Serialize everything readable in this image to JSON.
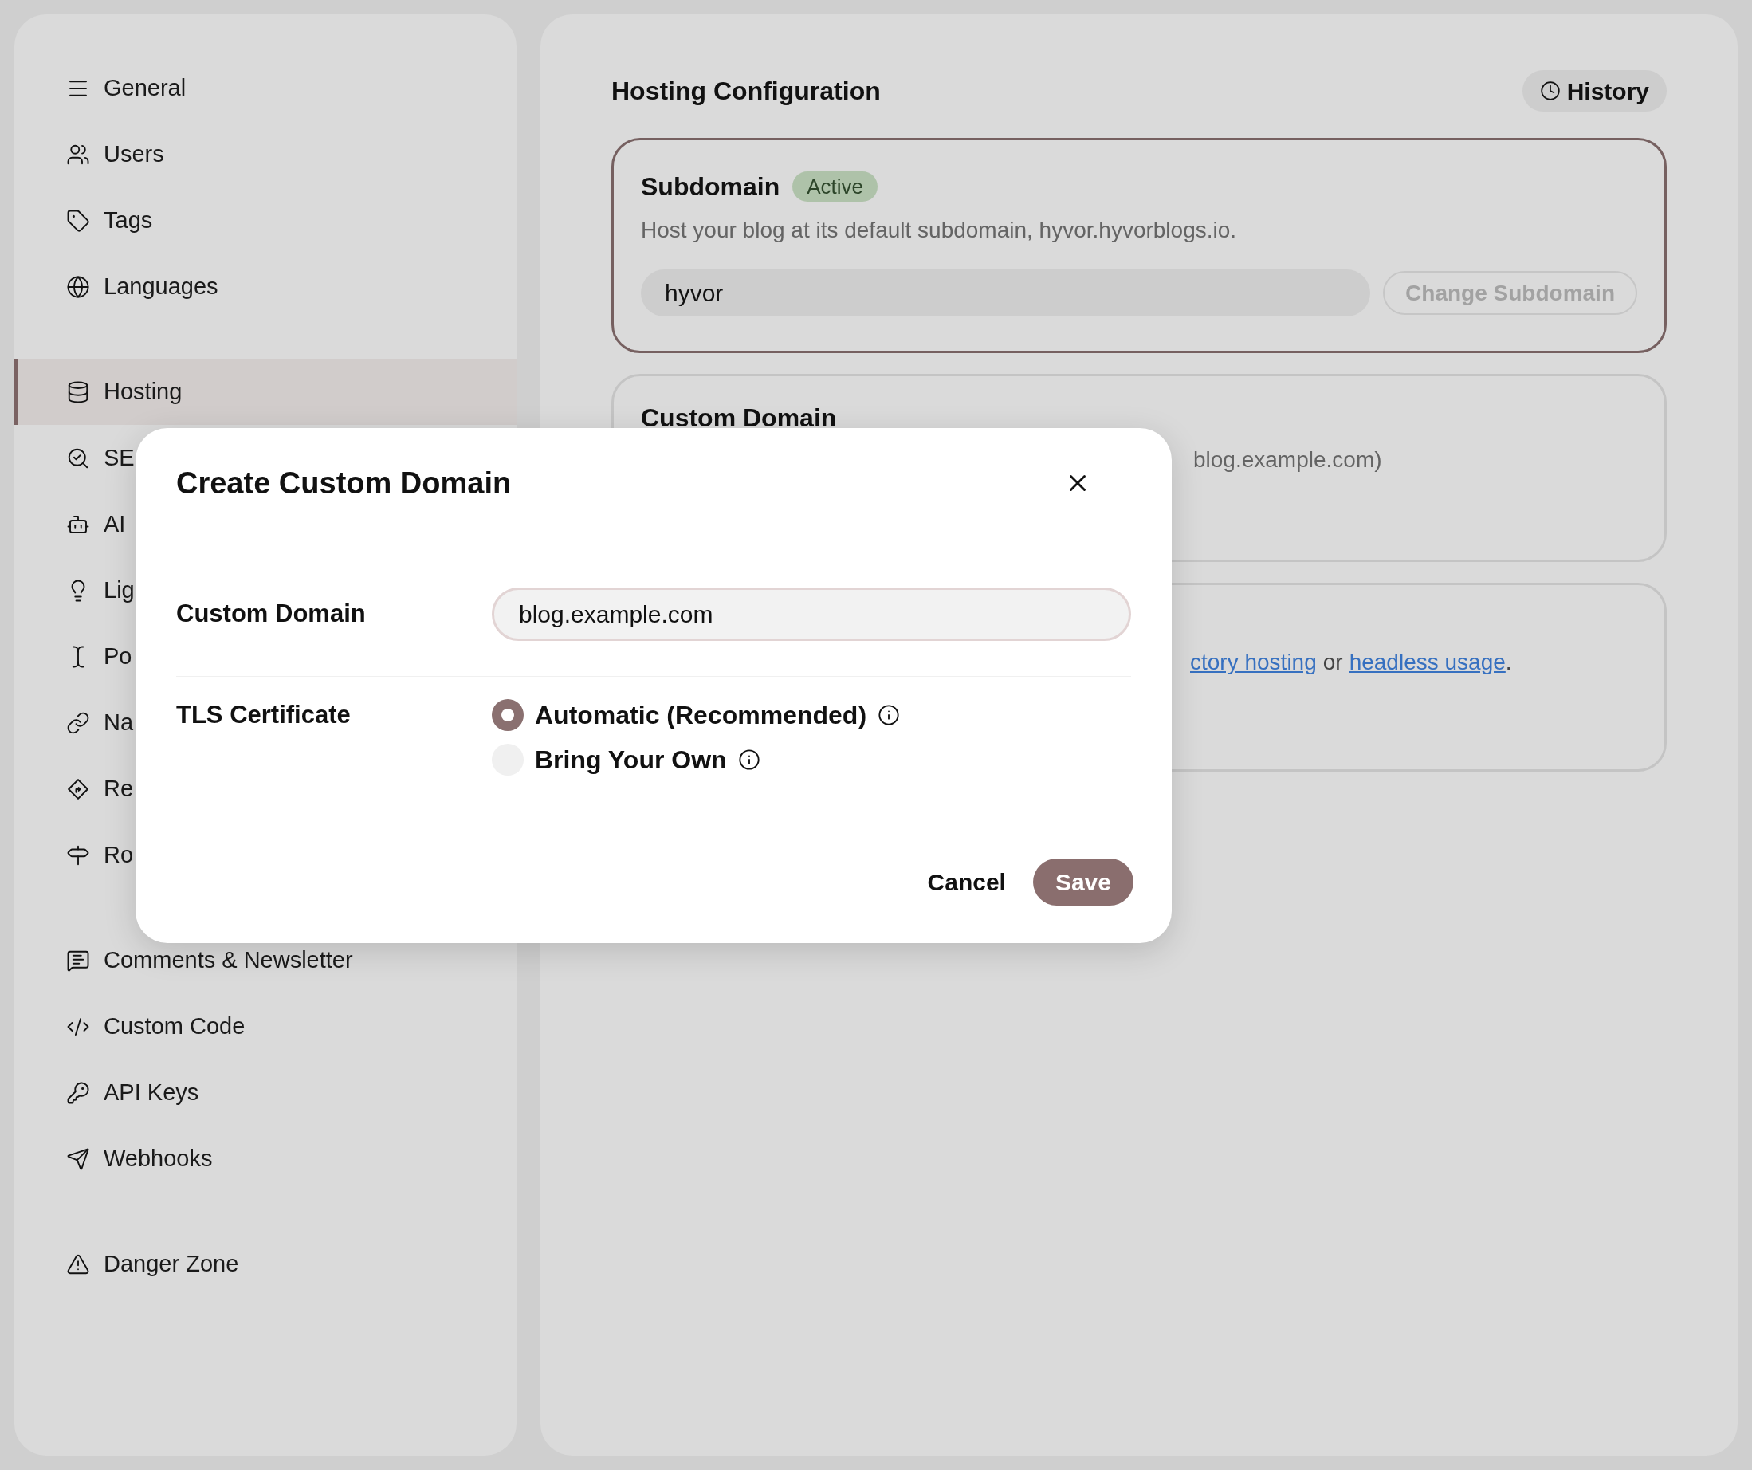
{
  "sidebar": {
    "groups": [
      [
        {
          "label": "General",
          "selected": false
        },
        {
          "label": "Users",
          "selected": false
        },
        {
          "label": "Tags",
          "selected": false
        },
        {
          "label": "Languages",
          "selected": false
        }
      ],
      [
        {
          "label": "Hosting",
          "selected": true
        },
        {
          "label": "SE",
          "selected": false
        },
        {
          "label": "AI",
          "selected": false
        },
        {
          "label": "Lig",
          "selected": false
        },
        {
          "label": "Po",
          "selected": false
        },
        {
          "label": "Na",
          "selected": false
        },
        {
          "label": "Re",
          "selected": false
        },
        {
          "label": "Ro",
          "selected": false
        }
      ],
      [
        {
          "label": "Comments & Newsletter",
          "selected": false
        },
        {
          "label": "Custom Code",
          "selected": false
        },
        {
          "label": "API Keys",
          "selected": false
        },
        {
          "label": "Webhooks",
          "selected": false
        }
      ],
      [
        {
          "label": "Danger Zone",
          "selected": false
        }
      ]
    ]
  },
  "main": {
    "title": "Hosting Configuration",
    "history_button": "History",
    "subdomain_card": {
      "title": "Subdomain",
      "badge": "Active",
      "selected": true,
      "description": "Host your blog at its default subdomain, hyvor.hyvorblogs.io.",
      "value": "hyvor",
      "button": {
        "label": "Change Subdomain",
        "disabled": true
      }
    },
    "custom_domain_card": {
      "title": "Custom Domain",
      "selected": false,
      "description": "blog.example.com)"
    },
    "third_card": {
      "selected": false,
      "link_1": "ctory hosting",
      "text": "or",
      "link_2": "headless usage",
      "end": "."
    }
  },
  "modal": {
    "title": "Create Custom Domain",
    "custom_domain": {
      "label": "Custom Domain",
      "value": "blog.example.com"
    },
    "tls": {
      "label": "TLS Certificate",
      "options": [
        {
          "label": "Automatic (Recommended)",
          "selected": true
        },
        {
          "label": "Bring Your Own",
          "selected": false
        }
      ]
    },
    "buttons": {
      "cancel": "Cancel",
      "save": "Save"
    }
  }
}
